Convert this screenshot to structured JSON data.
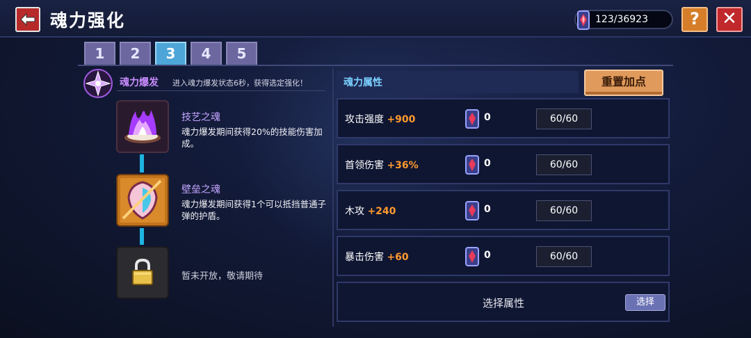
{
  "header": {
    "title": "魂力强化",
    "currency_value": "123/36923"
  },
  "tabs": [
    {
      "label": "1",
      "active": false
    },
    {
      "label": "2",
      "active": false
    },
    {
      "label": "3",
      "active": true
    },
    {
      "label": "4",
      "active": false
    },
    {
      "label": "5",
      "active": false
    }
  ],
  "burst": {
    "title": "魂力爆发",
    "desc": "进入魂力爆发状态6秒，获得选定强化！"
  },
  "souls": [
    {
      "name": "技艺之魂",
      "desc": "魂力爆发期间获得20%的技能伤害加成。"
    },
    {
      "name": "壁垒之魂",
      "desc": "魂力爆发期间获得1个可以抵挡普通子弹的护盾。"
    }
  ],
  "locked_text": "暂未开放，敬请期待",
  "attributes": {
    "header": "魂力属性",
    "reset_label": "重置加点",
    "rows": [
      {
        "name": "攻击强度",
        "bonus": "+900",
        "cost": "0",
        "cap": "60/60"
      },
      {
        "name": "首领伤害",
        "bonus": "+36%",
        "cost": "0",
        "cap": "60/60"
      },
      {
        "name": "木攻",
        "bonus": "+240",
        "cost": "0",
        "cap": "60/60"
      },
      {
        "name": "暴击伤害",
        "bonus": "+60",
        "cost": "0",
        "cap": "60/60"
      }
    ],
    "select_label": "选择属性",
    "select_button": "选择"
  },
  "colors": {
    "accent_orange": "#ff9a2e",
    "tab_active": "#4ea6d8",
    "connector": "#1eb4e0"
  }
}
